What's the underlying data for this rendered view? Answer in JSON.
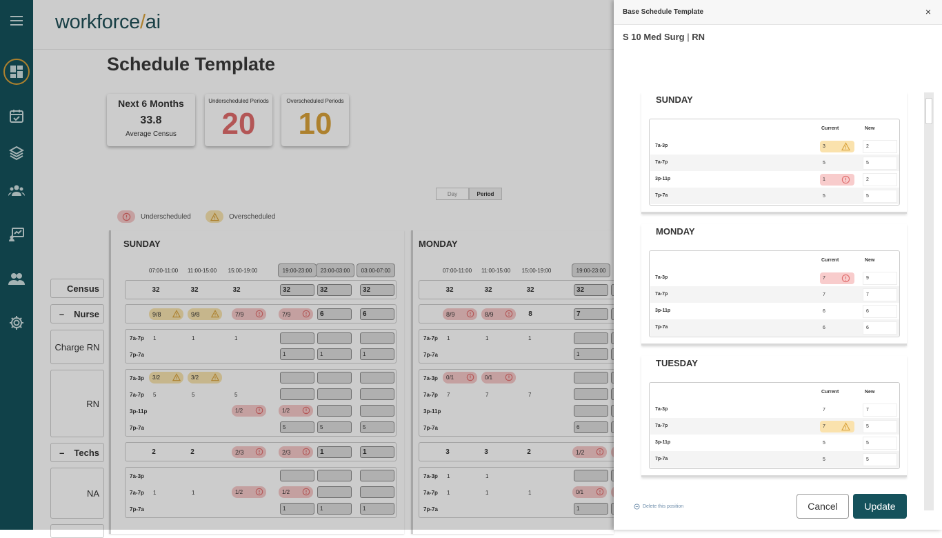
{
  "app": {
    "logo_text": "workforce",
    "logo_slash": "/",
    "logo_suffix": "ai"
  },
  "colors": {
    "sidebar": "#15525c",
    "red": "#e06c6c",
    "yellow": "#d9a23a",
    "accent": "#15525c"
  },
  "page": {
    "title": "Schedule Template"
  },
  "cards": {
    "census": {
      "title": "Next 6 Months",
      "value": "33.8",
      "caption": "Average Census"
    },
    "under": {
      "title": "Underscheduled Periods",
      "value": "20"
    },
    "over": {
      "title": "Overscheduled Periods",
      "value": "10"
    }
  },
  "toggle": {
    "day": "Day",
    "period": "Period",
    "selected": "Period"
  },
  "legend": {
    "under": "Underscheduled",
    "over": "Overscheduled"
  },
  "labels": {
    "census": "Census",
    "nurse": "Nurse",
    "charge": "Charge RN",
    "rn": "RN",
    "techs": "Techs",
    "na": "NA",
    "minus": "–"
  },
  "sunday": {
    "name": "SUNDAY",
    "times": [
      "07:00-11:00",
      "11:00-15:00",
      "15:00-19:00",
      "19:00-23:00",
      "23:00-03:00",
      "03:00-07:00"
    ],
    "census": [
      "32",
      "32",
      "32",
      "32",
      "32",
      "32"
    ],
    "nurse": [
      "9/8",
      "9/8",
      "7/9",
      "7/9",
      "6",
      "6"
    ],
    "charge_7a7p": [
      "1",
      "1",
      "1"
    ],
    "charge_7p7a": [
      "1",
      "1",
      "1"
    ],
    "rn_7a3p": [
      "3/2",
      "3/2"
    ],
    "rn_7a7p": [
      "5",
      "5",
      "5"
    ],
    "rn_3p11p": [
      "1/2",
      "1/2"
    ],
    "rn_7p7a": [
      "5",
      "5",
      "5"
    ],
    "techs": [
      "2",
      "2",
      "2/3",
      "2/3",
      "1",
      "1"
    ],
    "na_7a7p": [
      "1",
      "1",
      "1/2",
      "1/2"
    ],
    "na_7p7a": [
      "1",
      "1",
      "1"
    ]
  },
  "monday": {
    "name": "MONDAY",
    "times": [
      "07:00-11:00",
      "11:00-15:00",
      "15:00-19:00",
      "19:00-23:00"
    ],
    "census": [
      "32",
      "32",
      "32",
      "32",
      "3"
    ],
    "nurse": [
      "8/9",
      "8/9",
      "8",
      "7",
      "7"
    ],
    "charge_7a7p": [
      "1",
      "1",
      "1"
    ],
    "charge_7p7a": [
      "1",
      "1"
    ],
    "rn_7a3p": [
      "0/1",
      "0/1"
    ],
    "rn_7a7p": [
      "7",
      "7",
      "7"
    ],
    "rn_7p7a": [
      "6",
      "6"
    ],
    "techs": [
      "3",
      "3",
      "2",
      "1/2",
      "1"
    ],
    "na_7a3p": [
      "1",
      "1"
    ],
    "na_7a7p": [
      "1",
      "1",
      "1",
      "0/1"
    ],
    "na_7p7a": [
      "1",
      "1"
    ]
  },
  "shift_labels": {
    "s7a3p": "7a-3p",
    "s7a7p": "7a-7p",
    "s3p11p": "3p-11p",
    "s7p7a": "7p-7a"
  },
  "modal": {
    "title": "Base Schedule Template",
    "close": "×",
    "unit": "S 10 Med Surg",
    "sep": "|",
    "role": "RN",
    "col_current": "Current",
    "col_new": "New",
    "days": [
      {
        "name": "SUNDAY",
        "rows": [
          {
            "shift": "7a-3p",
            "current": "3",
            "new": "2",
            "flag": "over"
          },
          {
            "shift": "7a-7p",
            "current": "5",
            "new": "5",
            "flag": ""
          },
          {
            "shift": "3p-11p",
            "current": "1",
            "new": "2",
            "flag": "under"
          },
          {
            "shift": "7p-7a",
            "current": "5",
            "new": "5",
            "flag": ""
          }
        ]
      },
      {
        "name": "MONDAY",
        "rows": [
          {
            "shift": "7a-3p",
            "current": "7",
            "new": "9",
            "flag": "under"
          },
          {
            "shift": "7a-7p",
            "current": "7",
            "new": "7",
            "flag": ""
          },
          {
            "shift": "3p-11p",
            "current": "6",
            "new": "6",
            "flag": ""
          },
          {
            "shift": "7p-7a",
            "current": "6",
            "new": "6",
            "flag": ""
          }
        ]
      },
      {
        "name": "TUESDAY",
        "rows": [
          {
            "shift": "7a-3p",
            "current": "7",
            "new": "7",
            "flag": ""
          },
          {
            "shift": "7a-7p",
            "current": "7",
            "new": "5",
            "flag": "over"
          },
          {
            "shift": "3p-11p",
            "current": "5",
            "new": "5",
            "flag": ""
          },
          {
            "shift": "7p-7a",
            "current": "5",
            "new": "5",
            "flag": ""
          }
        ]
      }
    ],
    "delete_label": "Delete this position",
    "cancel": "Cancel",
    "update": "Update"
  }
}
